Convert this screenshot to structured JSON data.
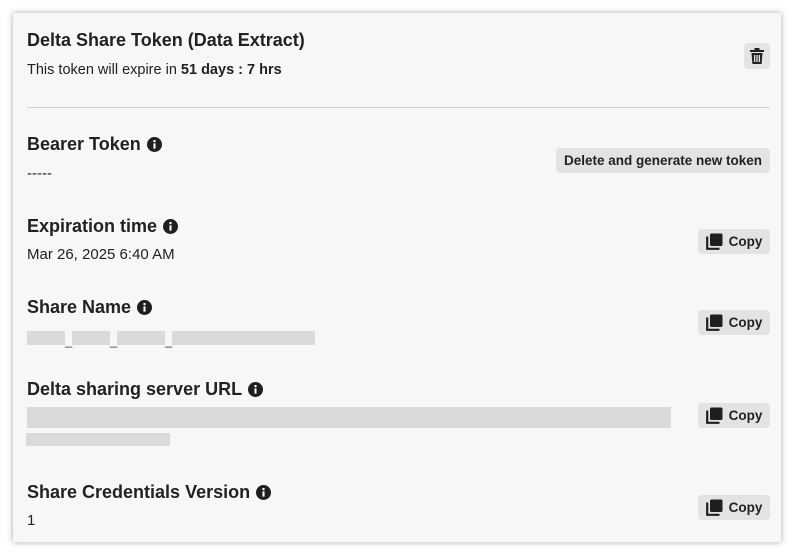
{
  "header": {
    "title": "Delta Share Token (Data Extract)",
    "expiry_prefix": "This token will expire in ",
    "expiry_value": "51 days : 7 hrs"
  },
  "bearer_token": {
    "label": "Bearer Token",
    "value": "-----",
    "button_label": "Delete and generate new token"
  },
  "expiration_time": {
    "label": "Expiration time",
    "value": "Mar 26, 2025 6:40 AM",
    "copy_label": "Copy"
  },
  "share_name": {
    "label": "Share Name",
    "copy_label": "Copy",
    "separators": [
      "_",
      "_",
      "_"
    ]
  },
  "server_url": {
    "label": "Delta sharing server URL",
    "copy_label": "Copy"
  },
  "credentials_version": {
    "label": "Share Credentials Version",
    "value": "1",
    "copy_label": "Copy"
  },
  "icons": {
    "delete": "trash-icon",
    "info": "info-icon",
    "copy": "copy-icon"
  }
}
